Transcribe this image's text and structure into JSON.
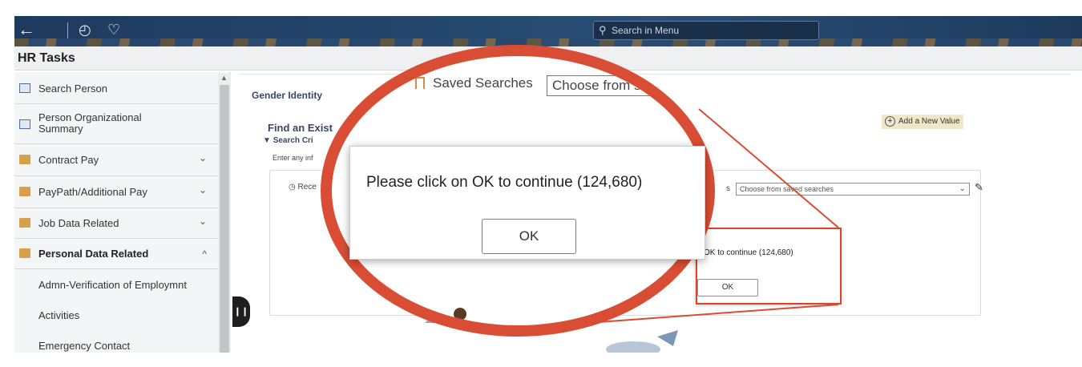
{
  "topbar": {
    "back_icon": "back-arrow-icon",
    "history_icon": "clock-icon",
    "favorites_icon": "heart-icon",
    "search_placeholder": "Search in Menu"
  },
  "page": {
    "title": "HR Tasks"
  },
  "sidebar": {
    "items": [
      {
        "label": "Search Person",
        "icon": "document-icon"
      },
      {
        "label": "Person Organizational Summary",
        "icon": "document-icon"
      },
      {
        "label": "Contract Pay",
        "icon": "folder-icon",
        "chevron": "⌄"
      },
      {
        "label": "PayPath/Additional Pay",
        "icon": "folder-icon",
        "chevron": "⌄"
      },
      {
        "label": "Job Data Related",
        "icon": "folder-icon",
        "chevron": "⌄"
      },
      {
        "label": "Personal Data Related",
        "icon": "folder-icon",
        "chevron": "^",
        "expanded": true
      }
    ],
    "sub_items": [
      {
        "label": "Admn-Verification of Employmnt"
      },
      {
        "label": "Activities"
      },
      {
        "label": "Emergency Contact"
      }
    ]
  },
  "main": {
    "section_title": "Gender Identity",
    "find_existing": "Find an Exist",
    "search_criteria": "Search Cri",
    "enter_any": "Enter any inf",
    "recent": "Rece",
    "add_new_value": "Add a New Value",
    "saved_searches_small_label": "s",
    "saved_searches_small_value": "Choose from saved searches"
  },
  "small_dialog": {
    "message": "OK to continue (124,680)",
    "ok_label": "OK"
  },
  "zoom": {
    "saved_searches_label": "Saved Searches",
    "saved_searches_select": "Choose from sav"
  },
  "big_dialog": {
    "message": "Please click on OK to continue (124,680)",
    "ok_label": "OK"
  },
  "colors": {
    "highlight_ring": "#d84d33",
    "banner": "#24476e",
    "link_text": "#37476a"
  }
}
